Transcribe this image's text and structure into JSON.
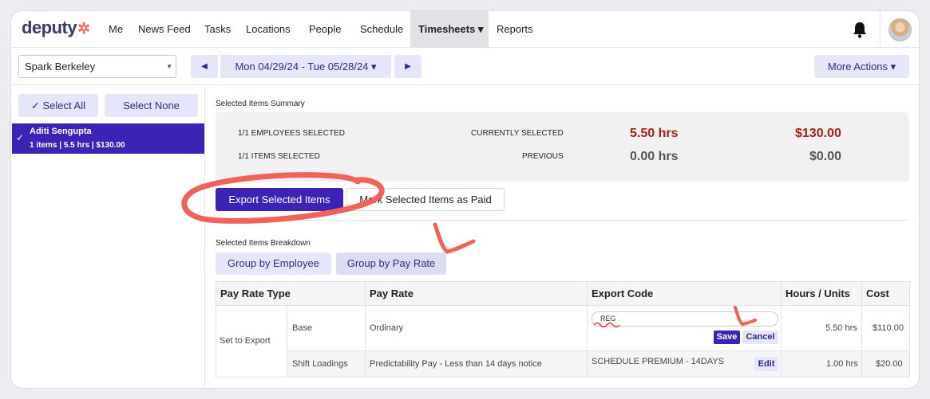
{
  "brand": {
    "name": "deputy",
    "star": "✲"
  },
  "nav": {
    "items": [
      "Me",
      "News Feed",
      "Tasks",
      "Locations",
      "People",
      "Schedule",
      "Timesheets ▾",
      "Reports"
    ]
  },
  "toolbar": {
    "location": "Spark Berkeley",
    "prev": "◀",
    "date_range": "Mon 04/29/24 - Tue 05/28/24 ▾",
    "next": "▶",
    "more_actions": "More Actions ▾"
  },
  "sidebar": {
    "select_all": "✓ Select All",
    "select_none": "Select None",
    "employee": {
      "check": "✓",
      "name": "Aditi Sengupta",
      "meta": "1 items | 5.5 hrs | $130.00"
    }
  },
  "summary": {
    "label": "Selected Items Summary",
    "employees_selected": "1/1 EMPLOYEES SELECTED",
    "items_selected": "1/1 ITEMS SELECTED",
    "current_label": "CURRENTLY SELECTED",
    "previous_label": "PREVIOUS",
    "current_hrs": "5.50 hrs",
    "current_cost": "$130.00",
    "previous_hrs": "0.00 hrs",
    "previous_cost": "$0.00",
    "current_color": "#a52016",
    "previous_color": "#555555"
  },
  "actions": {
    "export": "Export Selected Items",
    "mark_paid": "Mark Selected Items as Paid"
  },
  "breakdown": {
    "label": "Selected Items Breakdown",
    "group_employee": "Group by Employee",
    "group_pay_rate": "Group by Pay Rate"
  },
  "table": {
    "headers": [
      "Pay Rate Type",
      "Pay Rate",
      "Export Code",
      "Hours / Units",
      "Cost"
    ],
    "group_label": "Set to Export",
    "rows": [
      {
        "type": "Base",
        "rate": "Ordinary",
        "code": "REG",
        "hours": "5.50 hrs",
        "cost": "$110.00"
      },
      {
        "type": "Shift Loadings",
        "rate": "Predictability Pay - Less than 14 days notice",
        "code": "SCHEDULE PREMIUM - 14DAYS",
        "hours": "1.00 hrs",
        "cost": "$20.00"
      }
    ],
    "save": "Save",
    "cancel": "Cancel",
    "edit": "Edit"
  },
  "colors": {
    "accent": "#3c22b5",
    "accent_light": "#e6e6fa",
    "annotation": "#f0625a"
  }
}
